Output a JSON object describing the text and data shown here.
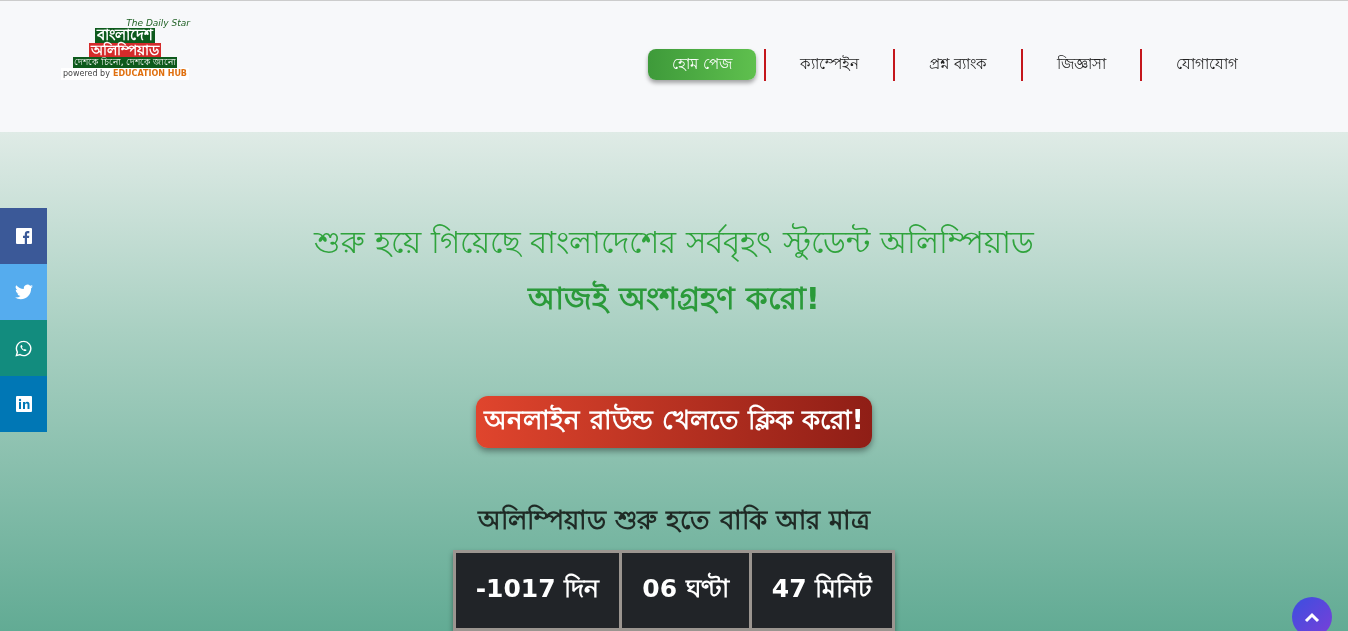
{
  "logo": {
    "brand": "The Daily Star",
    "title_top": "বাংলাদেশ",
    "title_bottom": "অলিম্পিয়াড",
    "tagline": "দেশকে চিনো, দেশকে জানো",
    "powered_by": "powered by",
    "partner": "EDUCATION HUB"
  },
  "nav": [
    {
      "label": "হোম পেজ",
      "selected": true
    },
    {
      "label": "ক্যাম্পেইন",
      "selected": false
    },
    {
      "label": "প্রশ্ন ব্যাংক",
      "selected": false
    },
    {
      "label": "জিজ্ঞাসা",
      "selected": false
    },
    {
      "label": "যোগাযোগ",
      "selected": false
    }
  ],
  "social": [
    {
      "kind": "facebook",
      "color": "#3b5998"
    },
    {
      "kind": "twitter",
      "color": "#55acee"
    },
    {
      "kind": "whatsapp",
      "color": "#128c7e"
    },
    {
      "kind": "linkedin",
      "color": "#0077b5"
    }
  ],
  "hero": {
    "headline": "শুরু হয়ে গিয়েছে বাংলাদেশের সর্ববৃহৎ স্টুডেন্ট অলিম্পিয়াড",
    "subheadline": "আজই অংশগ্রহণ করো!",
    "cta": "অনলাইন রাউন্ড খেলতে ক্লিক করো!",
    "countdown_title": "অলিম্পিয়াড শুরু হতে বাকি আর মাত্র",
    "countdown": [
      "-1017 দিন",
      "06 ঘণ্টা",
      "47 মিনিট"
    ]
  }
}
